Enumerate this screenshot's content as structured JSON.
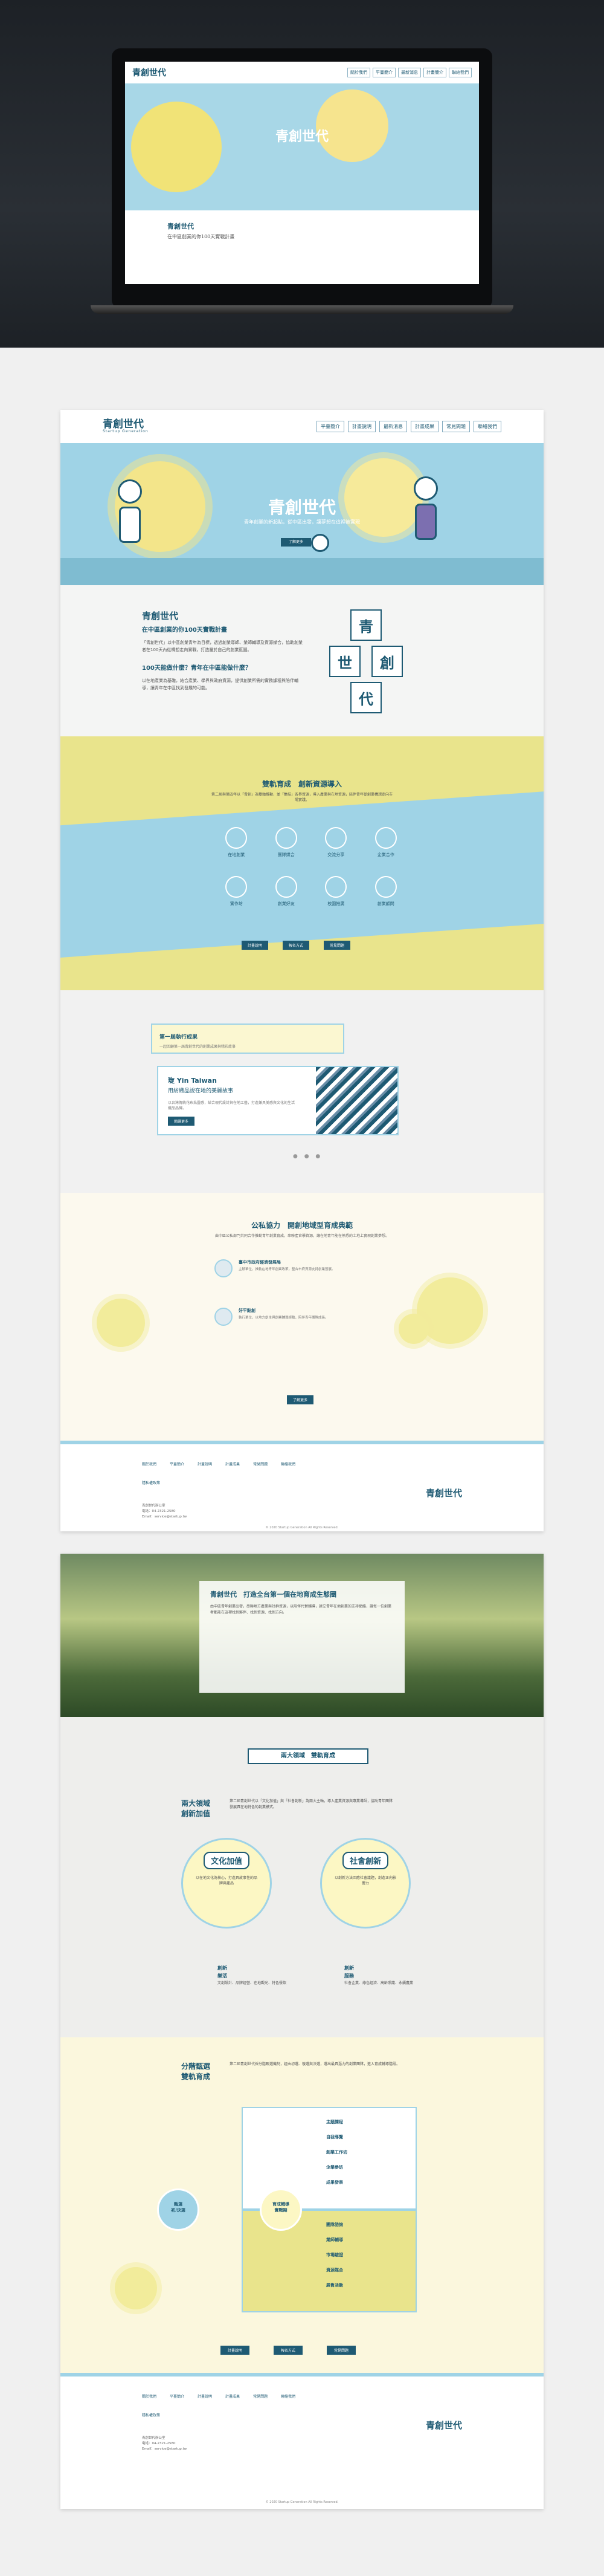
{
  "laptop": {
    "logo": "青創世代",
    "menu": [
      "關於我們",
      "平臺簡介",
      "最新消息",
      "計畫簡介",
      "聯絡我們"
    ],
    "banner_title": "青創世代",
    "text_title": "青創世代",
    "text_sub": "在中區創業的你100天實戰計畫"
  },
  "nav": {
    "logo": "青創世代",
    "logo_en": "Startup Generation",
    "menu": [
      "平臺簡介",
      "計畫說明",
      "最新消息",
      "計畫成果",
      "常見問題",
      "聯絡我們"
    ]
  },
  "banner": {
    "title": "青創世代",
    "subtitle": "青年創業的新起點，從中區出發，讓夢想在這裡被實現",
    "cta": "了解更多"
  },
  "intro": {
    "title": "青創世代",
    "subtitle": "在中區創業的你100天實戰計畫",
    "body": "「青創世代」以中區創業青年為目標，透過創業導師、業師輔導及資源媒合，協助創業者在100天內從構想走向實戰，打造屬於自己的創業藍圖。",
    "q": "100天能做什麼？青年在中區能做什麼？",
    "body2": "以在地產業為基礎，結合產業、學界與政府資源，提供創業所需的實務課程與陪伴輔導，讓青年在中區找到發展的可能。",
    "chars": [
      "青",
      "世",
      "創",
      "代"
    ]
  },
  "resource": {
    "title": "雙軌育成　創新資源導入",
    "desc": "第二屆與第四年以「青創」為雙軸推動，並「集結」各界資源，導入產業與在地資源，陪伴青年從創業構想走向市場實踐。",
    "items": [
      "在地創業",
      "團隊媒合",
      "交流分享",
      "企業合作",
      "實作坊",
      "創業好友",
      "校園推廣",
      "創業顧問"
    ],
    "buttons": [
      "計畫說明",
      "報名方式",
      "常見問題"
    ]
  },
  "news": {
    "card1_title": "第一屆執行成果",
    "card1_desc": "一起回顧第一屆青創世代的創業成果與精彩故事",
    "card2_title": "琁 Yin Taiwan",
    "card2_sub": "用紡織品說在地的美麗故事",
    "card2_desc": "以台灣傳統花布為靈感，結合現代設計與在地工藝，打造兼具美感與文化的生活織品品牌。",
    "card2_more": "閱讀更多",
    "dots": "● ● ●"
  },
  "coop": {
    "title": "公私協力　開創地域型育成典範",
    "desc": "由中區公私部門共同合作推動青年創業育成，串聯產官學資源，讓在地青年能在熟悉的土地上實現創業夢想。",
    "p1_title": "臺中市政府經濟發展局",
    "p1_desc": "主辦單位，推動在地青年創業政策，整合市府資源支持創業發展。",
    "p2_title": "好平點創",
    "p2_desc": "執行單位，以地方創生與創業輔導經驗，陪伴青年團隊成長。",
    "more": "了解更多"
  },
  "footer": {
    "links": [
      "關於我們",
      "平臺簡介",
      "計畫說明",
      "計畫成果",
      "常見問題",
      "聯絡我們",
      "隱私權政策"
    ],
    "info": "青創世代辦公室\n電話：04-2321-2580\nEmail：service@startup.tw",
    "copy": "© 2020 Startup Generation All Rights Reserved.",
    "logo": "青創世代"
  },
  "page2": {
    "grass_title": "青創世代　打造全台第一個在地育成生態圈",
    "grass_body": "由中區青年創業出發，串聯地方產業與社群資源，以陪伴代替輔導，建立青年在地創業的支持網絡，讓每一位創業者都能在這裡找到夥伴、找到資源、找到方向。",
    "tag": "兩大領域　雙軌育成",
    "h1": "兩大領域\n創新加值",
    "h1_desc": "第二屆青創世代以「文化加值」與「社會創新」為兩大主軸，導入產業資源與專業導師，協助青年團隊發展具在地特色的創業模式。",
    "bubble1": "文化加值",
    "bubble1_desc": "以在地文化為核心，打造具故事性的品牌與產品",
    "bubble2": "社會創新",
    "bubble2_desc": "以創新方法回應社會議題，創造正向影響力",
    "field1": "創新\n樂活",
    "field1_desc": "文創設計、品牌經營、在地觀光、特色餐飲",
    "field2": "創新\n服務",
    "field2_desc": "社會企業、綠色經濟、高齡照護、永續農業",
    "h2": "分階甄選\n雙軌育成",
    "h2_desc": "第二屆青創世代採分階甄選機制，經由初選、複選與決選，選出最具潛力的創業團隊，進入育成輔導階段。",
    "rows_top": [
      "主題課程",
      "自我導覽",
      "創業工作坊",
      "企業參訪",
      "成果發表"
    ],
    "rows_bot": [
      "團隊諮詢",
      "業師輔導",
      "市場驗證",
      "資源媒合",
      "展售活動"
    ],
    "circle_left": "甄選\n初/決選",
    "circle_mid": "育成輔導\n實戰期",
    "buttons": [
      "計畫說明",
      "報名方式",
      "常見問題"
    ]
  }
}
